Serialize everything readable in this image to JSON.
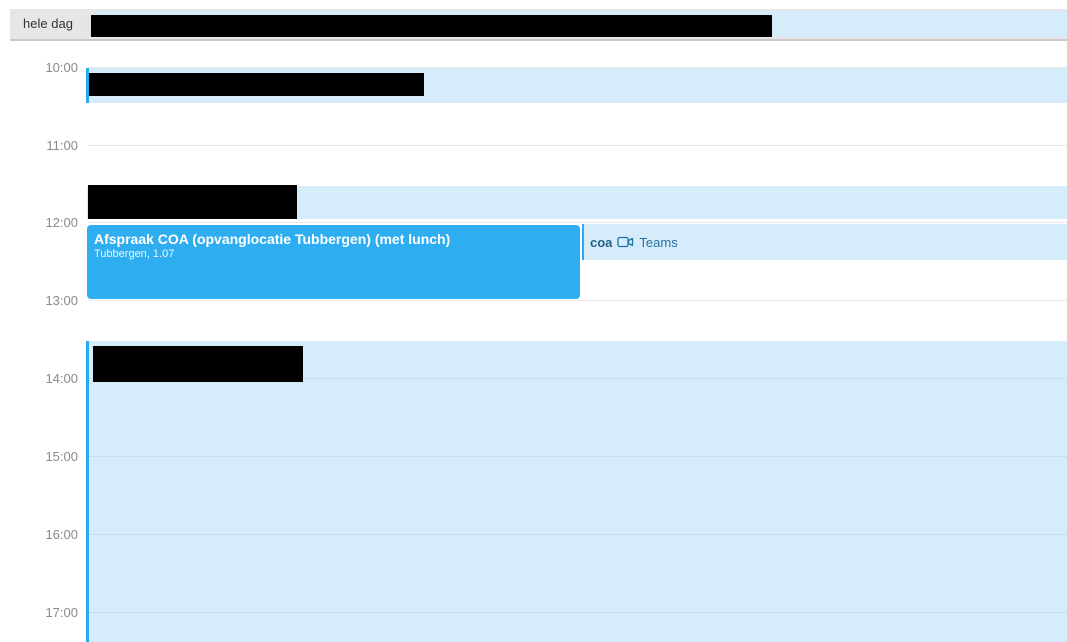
{
  "allday": {
    "label": "hele dag"
  },
  "times": [
    "10:00",
    "11:00",
    "12:00",
    "13:00",
    "14:00",
    "15:00",
    "16:00",
    "17:00"
  ],
  "events": {
    "afspraak": {
      "title": "Afspraak COA (opvanglocatie Tubbergen) (met lunch)",
      "location": "Tubbergen, 1.07"
    },
    "coa": {
      "name": "coa",
      "meeting": "Teams",
      "icon": "video-camera-icon"
    }
  },
  "colors": {
    "event_light": "#d6ecfa",
    "event_accent": "#2aa9ee",
    "event_selected": "#2eaef0"
  }
}
